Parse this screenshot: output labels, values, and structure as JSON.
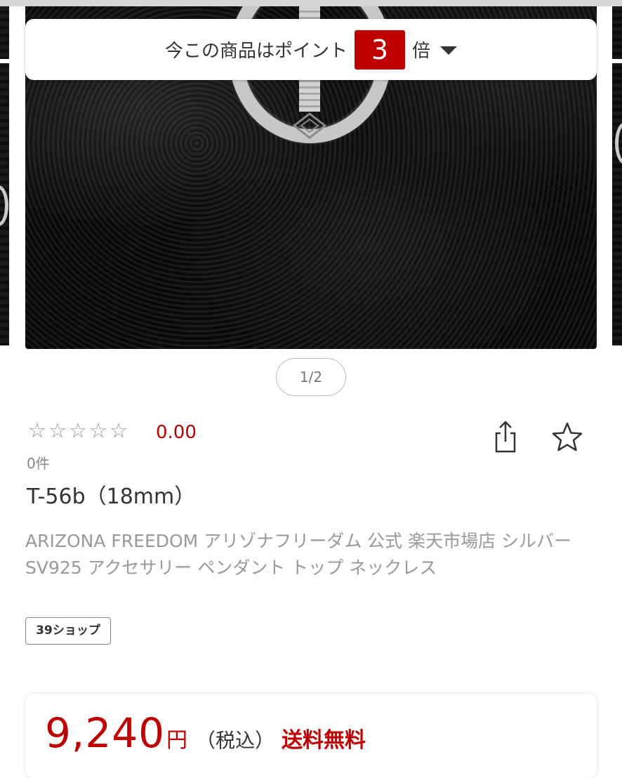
{
  "points_banner": {
    "text_before": "今この商品はポイント",
    "multiplier": "3",
    "text_after": "倍"
  },
  "gallery": {
    "pager": "1/2"
  },
  "product": {
    "stars": [
      "☆",
      "☆",
      "☆",
      "☆",
      "☆"
    ],
    "rating": "0.00",
    "review_count": "0件",
    "title": "T-56b（18mm）",
    "description": "ARIZONA FREEDOM アリゾナフリーダム 公式 楽天市場店 シルバー SV925 アクセサリー ペンダント トップ ネックレス",
    "shop_badge": "39ショップ"
  },
  "price": {
    "value": "9,240",
    "currency": "円",
    "tax_note": "（税込）",
    "shipping": "送料無料"
  },
  "icons": {
    "share": "share-icon",
    "favorite": "star-outline-icon",
    "dropdown": "caret-down-icon"
  },
  "colors": {
    "accent": "#bf0000"
  }
}
